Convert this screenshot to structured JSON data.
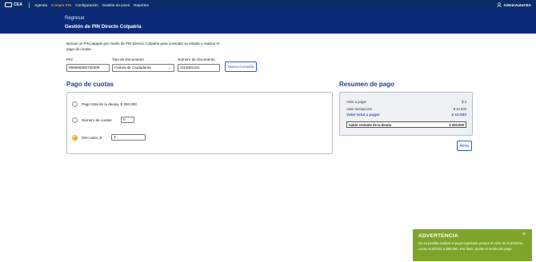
{
  "nav": {
    "logo_text": "CEA",
    "items": [
      "Agenda",
      "Compra PIN",
      "Configuración",
      "Gestión de pines",
      "Reportes"
    ],
    "active_index": 1,
    "user": "AdminAutoCEA"
  },
  "hero": {
    "back": "Regresar",
    "title": "Gestión de PIN Directo Colpatria"
  },
  "description": "Buscar un PIN pagado por medio de PIN Directo Colpatria para consultar su estado y realizar el pago de cuotas.",
  "form": {
    "pin_label": "PIN",
    "pin_value": "896655590725309",
    "doc_type_label": "Tipo de Documento",
    "doc_type_value": "Cédula de Ciudadanía",
    "doc_number_label": "Número de documento",
    "doc_number_value": "1115081441",
    "search_button": "Nueva Consulta"
  },
  "pago": {
    "title": "Pago de cuotas",
    "option_total": "Pago total de la deuda, $ 200.000",
    "option_cuotas": "Número de cuotas",
    "cuotas_value": "0",
    "option_otro": "Otro valor, $",
    "otro_value": "3",
    "selected": "otro"
  },
  "resumen": {
    "title": "Resumen de pago",
    "rows": [
      {
        "label": "Valor a pagar",
        "value": "$ 3"
      },
      {
        "label": "Valor transacción",
        "value": "$ 10.000"
      }
    ],
    "total_label": "Valor total a pagar",
    "total_value": "$ 10.000",
    "saldo_label": "Saldo restante de la deuda",
    "saldo_value": "$ 200.000"
  },
  "back_button": "Atrás",
  "toast": {
    "title": "ADVERTENCIA",
    "message": "No es posible realizar el pago ingresado porque el valor de la próxima cuota es inferior a $50.000. Por favor, ajuste el monto del pago.",
    "close": "×"
  },
  "colors": {
    "nav_bg": "#0b2c6b",
    "hero_bg": "#0a2a78",
    "accent": "#2d5bd1",
    "active_nav": "#f5c542",
    "radio_selected": "#e5a01d",
    "toast_bg": "#7ea52a"
  }
}
